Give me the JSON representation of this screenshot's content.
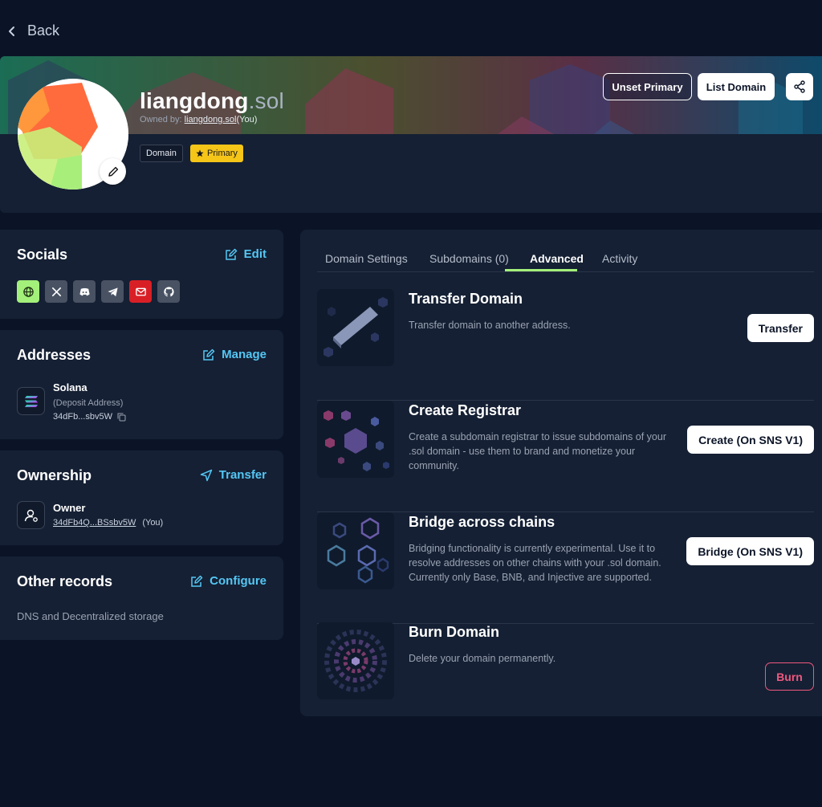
{
  "nav": {
    "back_label": "Back"
  },
  "profile": {
    "name": "liangdong",
    "tld": ".sol",
    "owned_by_prefix": "Owned by:",
    "owned_by_link": "liangdong.sol",
    "owned_by_suffix": "(You)",
    "tags": {
      "domain": "Domain",
      "primary": "Primary"
    },
    "actions": {
      "unset_primary": "Unset Primary",
      "list_domain": "List Domain"
    }
  },
  "socials": {
    "title": "Socials",
    "action": "Edit",
    "items": [
      "website-icon",
      "x-icon",
      "discord-icon",
      "telegram-icon",
      "email-icon",
      "github-icon"
    ]
  },
  "addresses": {
    "title": "Addresses",
    "action": "Manage",
    "chain": "Solana",
    "label": "(Deposit Address)",
    "address": "34dFb...sbv5W"
  },
  "ownership": {
    "title": "Ownership",
    "action": "Transfer",
    "role": "Owner",
    "address": "34dFb4Q...BSsbv5W",
    "you": "(You)"
  },
  "other_records": {
    "title": "Other records",
    "action": "Configure",
    "description": "DNS and Decentralized storage"
  },
  "tabs": [
    "Domain Settings",
    "Subdomains (0)",
    "Advanced",
    "Activity"
  ],
  "active_tab": "Advanced",
  "advanced": [
    {
      "title": "Transfer Domain",
      "description": "Transfer domain to another address.",
      "button": "Transfer"
    },
    {
      "title": "Create Registrar",
      "description": "Create a subdomain registrar to issue subdomains of your .sol domain - use them to brand and monetize your community.",
      "button": "Create (On SNS V1)"
    },
    {
      "title": "Bridge across chains",
      "description": "Bridging functionality is currently experimental. Use it to resolve addresses on other chains with your .sol domain. Currently only Base, BNB, and Injective are supported.",
      "button": "Bridge (On SNS V1)"
    },
    {
      "title": "Burn Domain",
      "description": "Delete your domain permanently.",
      "button": "Burn"
    }
  ],
  "colors": {
    "background": "#0b1427",
    "card": "#152034",
    "accent_link": "#54c7f4",
    "accent_green": "#a3f07a",
    "primary_tag": "#f5c518",
    "danger": "#f0587e"
  }
}
